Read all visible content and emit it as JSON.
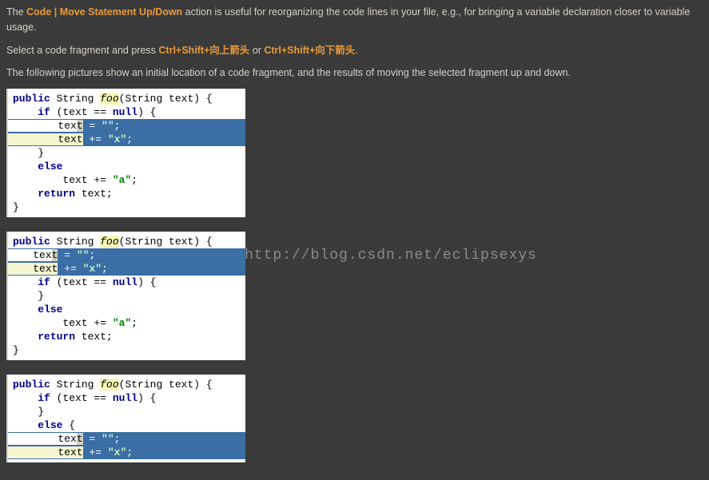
{
  "intro": {
    "t1": "The ",
    "action": "Code | Move Statement Up/Down",
    "t2": " action is useful for reorganizing the code lines in your file, e.g., for bringing a variable declaration closer to variable usage."
  },
  "shortcuts": {
    "t1": "Select a code fragment and press ",
    "s1": "Ctrl+Shift+向上箭头",
    "t2": " or ",
    "s2": "Ctrl+Shift+向下箭头",
    "t3": "."
  },
  "explain": "The following pictures show an initial location of a code fragment, and the results of moving the selected fragment up and down.",
  "watermark": "http://blog.csdn.net/eclipsexys",
  "code1": {
    "l1a": "public",
    "l1b": " String ",
    "l1c": "foo",
    "l1d": "(String text) {",
    "l2a": "    ",
    "l2b": "if",
    "l2c": " (text == ",
    "l2d": "null",
    "l2e": ") {",
    "l3_pre": "        tex",
    "l3_caret": "t",
    "l3_mid": " = ",
    "l3_str": "\"\"",
    "l3_end": ";",
    "l4_pre": "        text",
    "l4_mid": " += ",
    "l4_str": "\"x\"",
    "l4_end": ";",
    "l5": "    }",
    "l6a": "    ",
    "l6b": "else",
    "l7a": "        text += ",
    "l7b": "\"a\"",
    "l7c": ";",
    "l8a": "    ",
    "l8b": "return",
    "l8c": " text;",
    "l9": "}"
  },
  "code2": {
    "l1a": "public",
    "l1b": " String ",
    "l1c": "foo",
    "l1d": "(String text) {",
    "l2_pre": "    tex",
    "l2_caret": "t",
    "l2_mid": " = ",
    "l2_str": "\"\"",
    "l2_end": ";",
    "l3_pre": "    text",
    "l3_mid": " += ",
    "l3_str": "\"x\"",
    "l3_end": ";",
    "l4a": "    ",
    "l4b": "if",
    "l4c": " (text == ",
    "l4d": "null",
    "l4e": ") {",
    "l5": "    }",
    "l6a": "    ",
    "l6b": "else",
    "l7a": "        text += ",
    "l7b": "\"a\"",
    "l7c": ";",
    "l8a": "    ",
    "l8b": "return",
    "l8c": " text;",
    "l9": "}"
  },
  "code3": {
    "l1a": "public",
    "l1b": " String ",
    "l1c": "foo",
    "l1d": "(String text) {",
    "l2a": "    ",
    "l2b": "if",
    "l2c": " (text == ",
    "l2d": "null",
    "l2e": ") {",
    "l3": "    }",
    "l4a": "    ",
    "l4b": "else",
    "l4c": " {",
    "l5_pre": "        tex",
    "l5_caret": "t",
    "l5_mid": " = ",
    "l5_str": "\"\"",
    "l5_end": ";",
    "l6_pre": "        text",
    "l6_mid": " += ",
    "l6_str": "\"x\"",
    "l6_end": ";"
  }
}
